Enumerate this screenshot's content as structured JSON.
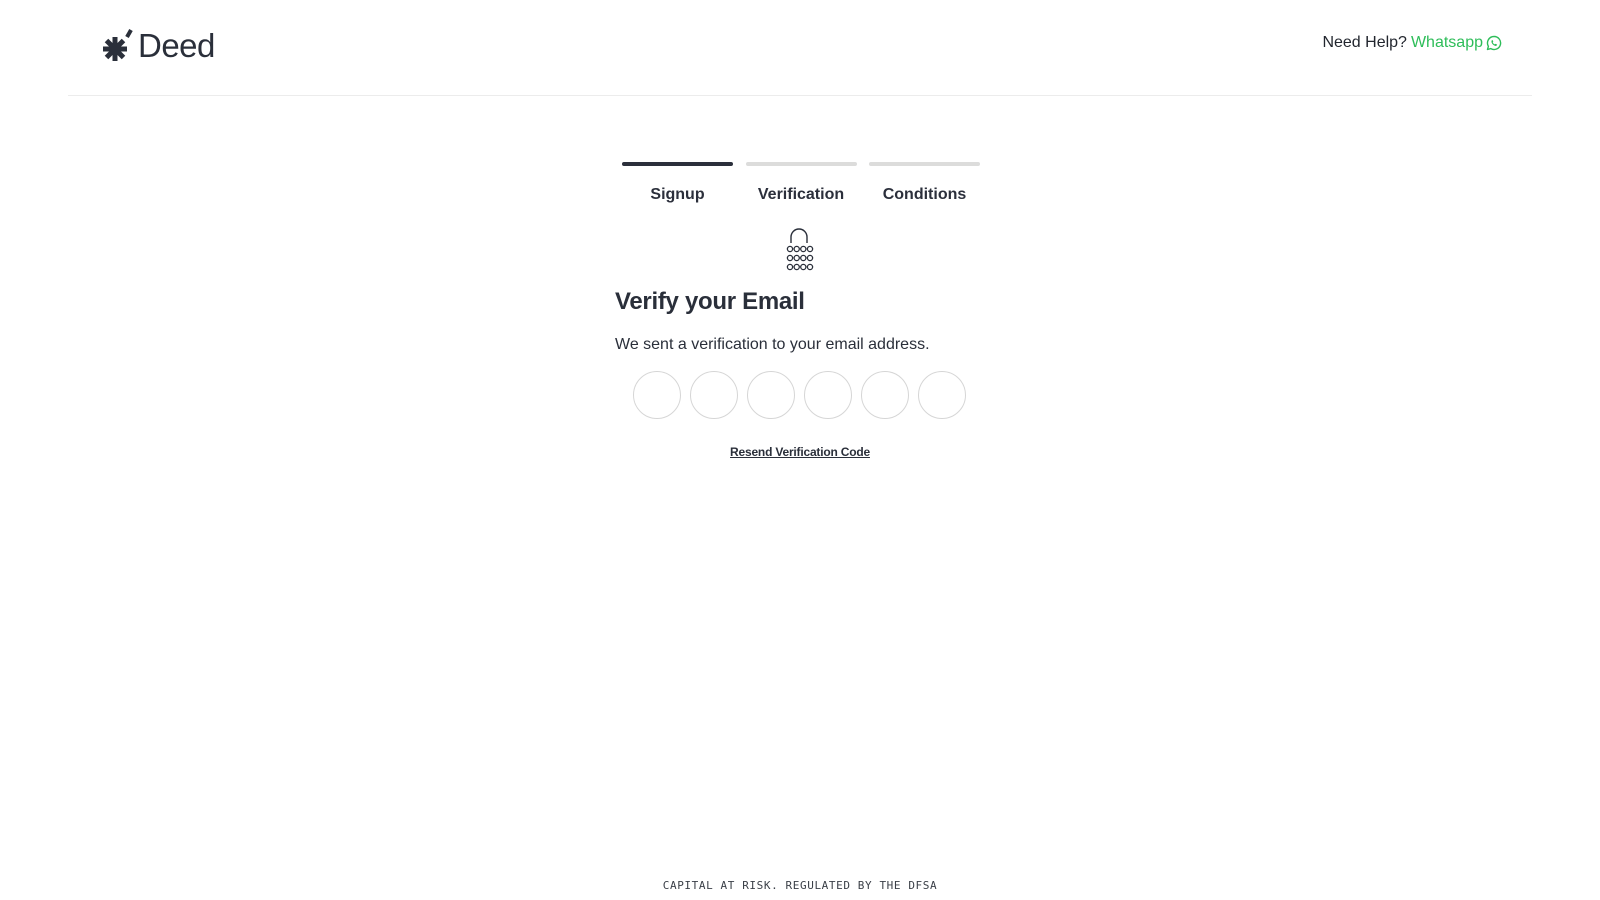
{
  "header": {
    "logo_text": "Deed",
    "help_label": "Need Help?",
    "help_link": "Whatsapp"
  },
  "stepper": {
    "steps": [
      {
        "label": "Signup",
        "status": "active"
      },
      {
        "label": "Verification",
        "status": "inactive"
      },
      {
        "label": "Conditions",
        "status": "inactive"
      }
    ]
  },
  "main": {
    "icon": "lock-keypad-icon",
    "title": "Verify your Email",
    "subtitle": "We sent a verification to your email address.",
    "code_fields": [
      "",
      "",
      "",
      "",
      "",
      ""
    ],
    "resend_label": "Resend Verification Code"
  },
  "footer": {
    "disclaimer": "CAPITAL AT RISK. REGULATED BY THE DFSA"
  },
  "colors": {
    "text": "#2a2f3a",
    "accent": "#2ebd59",
    "step_active": "#2b2f3b",
    "step_inactive": "#dcdcdb",
    "input_border": "#d6d6d6"
  }
}
